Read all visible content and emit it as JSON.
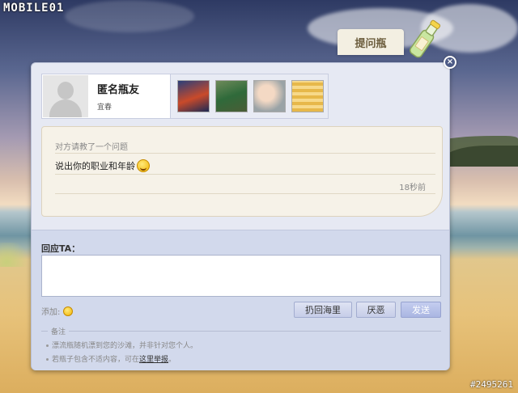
{
  "logo_text": "MOBILE01",
  "watermark": "#2495261",
  "bottle_tab_label": "提问瓶",
  "dialog": {
    "close_label": "×",
    "profile": {
      "name": "匿名瓶友",
      "location": "宜春",
      "photos": [
        "photo-1",
        "photo-2",
        "photo-3",
        "photo-4"
      ]
    },
    "message": {
      "header": "对方请教了一个问题",
      "text": "说出你的职业和年龄",
      "time": "18秒前"
    },
    "reply": {
      "label": "回应TA：",
      "input_value": "",
      "add_label": "添加:",
      "throw_back_button": "扔回海里",
      "hate_button": "厌恶",
      "send_button": "发送"
    },
    "notes": {
      "title": "备注",
      "items": [
        "漂流瓶随机漂到您的沙滩，并非针对您个人。",
        "若瓶子包含不适内容，可在"
      ],
      "report_link": "这里举报",
      "report_suffix": "。"
    }
  }
}
